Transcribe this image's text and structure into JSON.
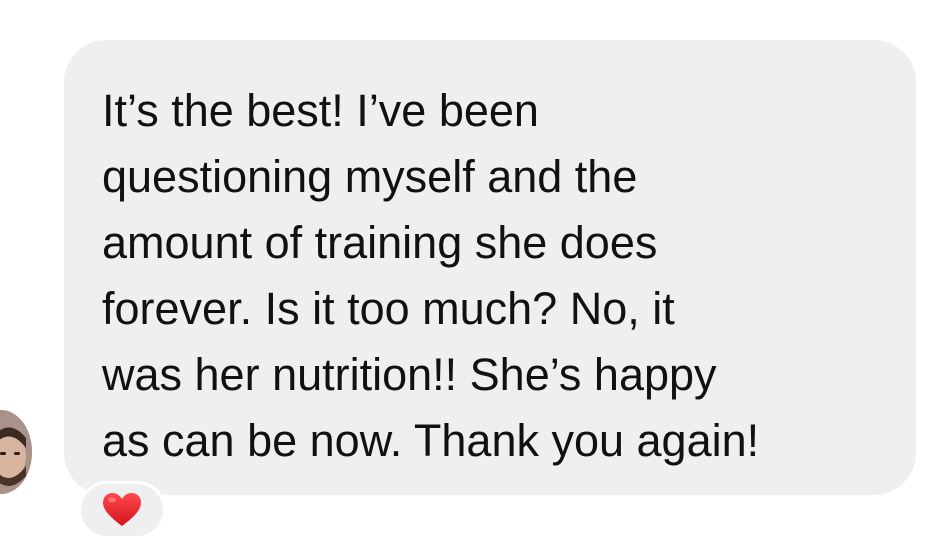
{
  "message": {
    "text": "It’s the best! I’ve been\nquestioning myself and the\namount of training she does\nforever. Is it too much? No, it\nwas her nutrition!! She’s happy\nas can be now. Thank you again!"
  },
  "reaction": {
    "icon": "heart-icon",
    "color": "#e8202a"
  },
  "colors": {
    "bubble": "#efeff2",
    "text": "#111111",
    "background": "#ffffff"
  }
}
